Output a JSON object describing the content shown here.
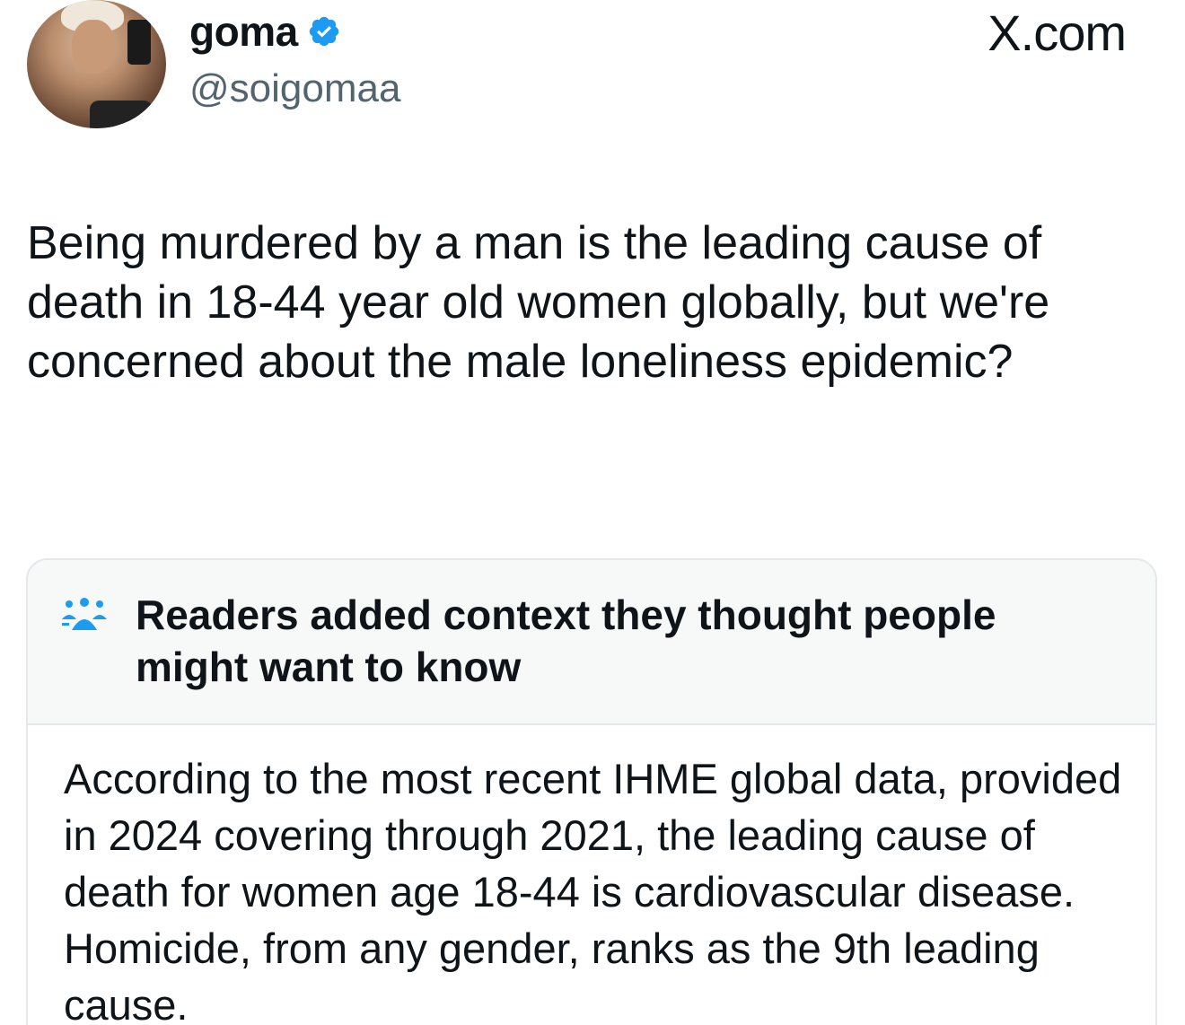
{
  "author": {
    "display_name": "goma",
    "handle": "@soigomaa",
    "verified": true
  },
  "brand": "X.com",
  "tweet": {
    "text": "Being murdered by a man is the leading cause of death in 18-44 year old women globally, but we're concerned about the male loneliness epidemic?"
  },
  "community_note": {
    "title": "Readers added context they thought people might want to know",
    "body": "According to the most recent IHME global data, provided in 2024 covering through 2021, the leading cause of death for women age 18-44 is cardiovascular disease. Homicide, from any gender, ranks as the 9th leading cause."
  },
  "colors": {
    "verified_blue": "#1d9bf0",
    "note_icon_blue": "#1d9bf0",
    "secondary_text": "#536471"
  },
  "icons": {
    "verified": "verified-badge-icon",
    "note": "community-notes-icon"
  }
}
